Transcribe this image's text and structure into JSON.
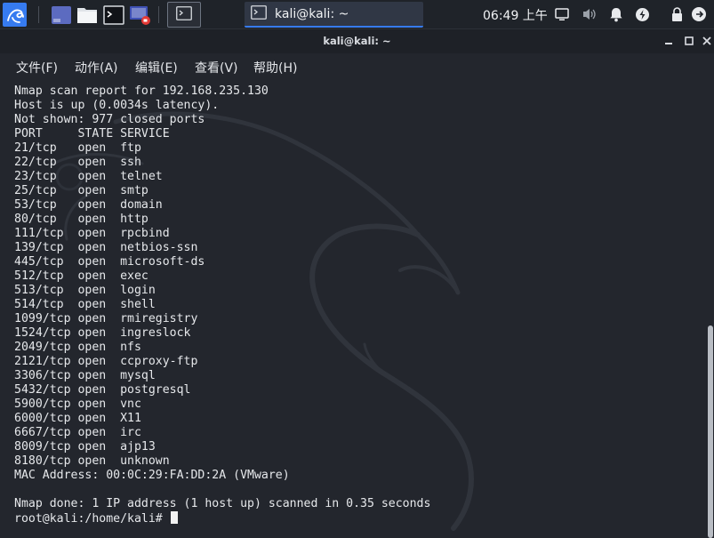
{
  "panel": {
    "launchers": [
      {
        "icon": "kali-menu-icon"
      },
      {
        "icon": "workspace-switcher-icon"
      },
      {
        "icon": "file-manager-icon"
      },
      {
        "icon": "terminal-icon"
      },
      {
        "icon": "screen-recorder-icon"
      }
    ],
    "taskbar": [
      {
        "icon": "terminal-icon",
        "label": ""
      },
      {
        "icon": "terminal-icon",
        "label": "kali@kali: ~"
      }
    ],
    "clock": "06:49 上午",
    "tray_icons": [
      "display-icon",
      "volume-icon",
      "notifications-icon",
      "power-icon",
      "lock-icon",
      "logout-icon"
    ]
  },
  "window": {
    "title": "kali@kali: ~",
    "controls": [
      "minimize-icon",
      "maximize-icon",
      "close-icon"
    ]
  },
  "menu": {
    "items": [
      "文件(F)",
      "动作(A)",
      "编辑(E)",
      "查看(V)",
      "帮助(H)"
    ]
  },
  "terminal": {
    "lines": [
      "Nmap scan report for 192.168.235.130",
      "Host is up (0.0034s latency).",
      "Not shown: 977 closed ports",
      "PORT     STATE SERVICE",
      "21/tcp   open  ftp",
      "22/tcp   open  ssh",
      "23/tcp   open  telnet",
      "25/tcp   open  smtp",
      "53/tcp   open  domain",
      "80/tcp   open  http",
      "111/tcp  open  rpcbind",
      "139/tcp  open  netbios-ssn",
      "445/tcp  open  microsoft-ds",
      "512/tcp  open  exec",
      "513/tcp  open  login",
      "514/tcp  open  shell",
      "1099/tcp open  rmiregistry",
      "1524/tcp open  ingreslock",
      "2049/tcp open  nfs",
      "2121/tcp open  ccproxy-ftp",
      "3306/tcp open  mysql",
      "5432/tcp open  postgresql",
      "5900/tcp open  vnc",
      "6000/tcp open  X11",
      "6667/tcp open  irc",
      "8009/tcp open  ajp13",
      "8180/tcp open  unknown",
      "MAC Address: 00:0C:29:FA:DD:2A (VMware)",
      "",
      "Nmap done: 1 IP address (1 host up) scanned in 0.35 seconds"
    ],
    "prompt": "root@kali:/home/kali# ",
    "scroll_position": 1.0
  },
  "colors": {
    "panel_bg": "#1f2329",
    "terminal_bg": "#23262d",
    "text": "#e6e8eb",
    "accent": "#367bf0"
  }
}
